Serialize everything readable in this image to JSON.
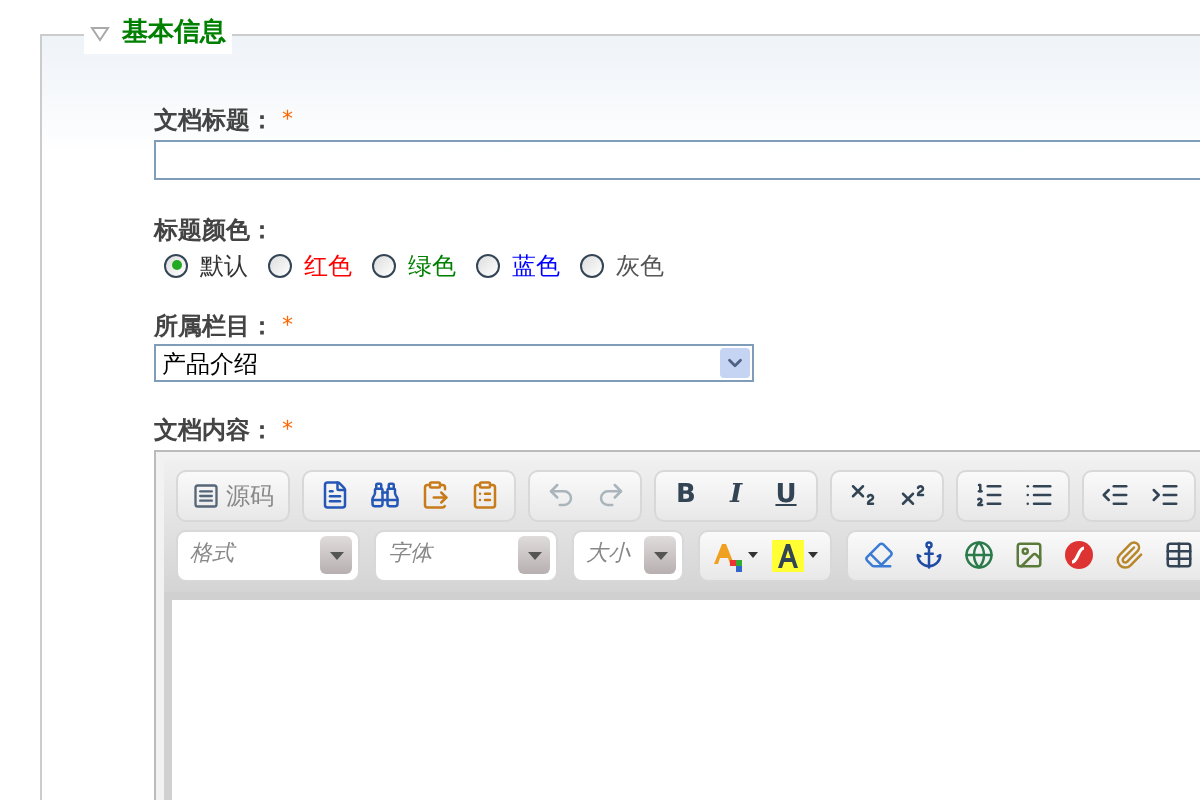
{
  "section": {
    "title": "基本信息",
    "expanded": true
  },
  "doc_title": {
    "label": "文档标题：",
    "required_mark": "*"
  },
  "title_color": {
    "label": "标题颜色：",
    "options": [
      {
        "label": "默认",
        "selected": true,
        "color": "#333333"
      },
      {
        "label": "红色",
        "selected": false,
        "color": "#ff0000"
      },
      {
        "label": "绿色",
        "selected": false,
        "color": "#008000"
      },
      {
        "label": "蓝色",
        "selected": false,
        "color": "#0000ff"
      },
      {
        "label": "灰色",
        "selected": false,
        "color": "#555555"
      }
    ]
  },
  "column": {
    "label": "所属栏目：",
    "required_mark": "*",
    "value": "产品介绍"
  },
  "content": {
    "label": "文档内容：",
    "required_mark": "*",
    "editor": {
      "source_button": "源码",
      "bold": "B",
      "italic": "I",
      "underline": "U",
      "combos": [
        "格式",
        "字体",
        "大小"
      ]
    }
  }
}
